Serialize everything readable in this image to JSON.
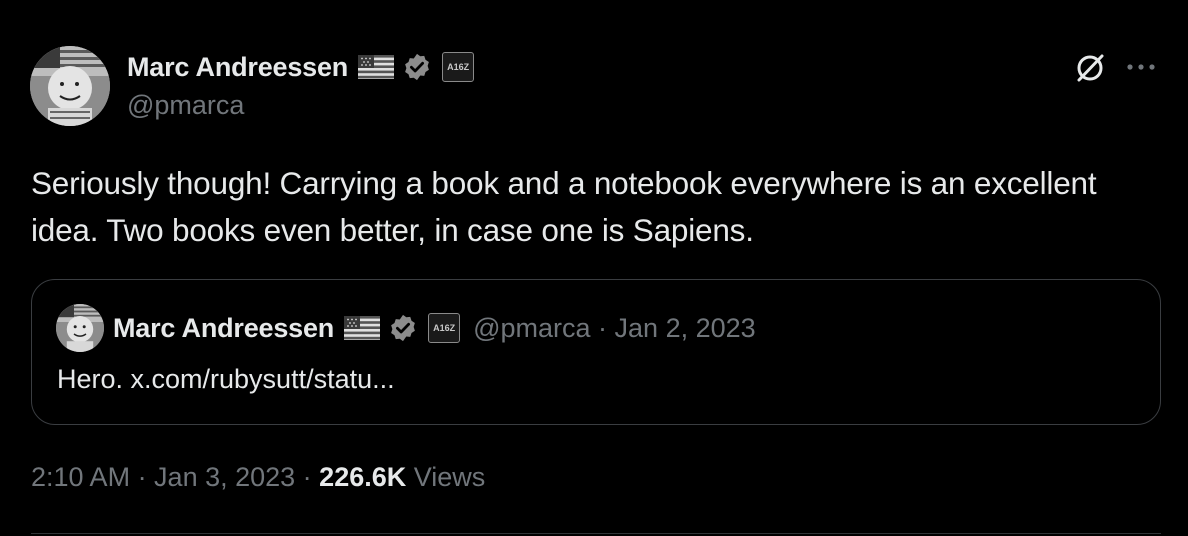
{
  "author": {
    "name": "Marc Andreessen",
    "handle": "@pmarca",
    "affiliation_badge": "A16Z"
  },
  "tweet": {
    "text": "Seriously though! Carrying a book and a notebook everywhere is an excellent idea. Two books even better, in case one is Sapiens."
  },
  "quoted_tweet": {
    "name": "Marc Andreessen",
    "affiliation_badge": "A16Z",
    "meta": "@pmarca · Jan 2, 2023",
    "text": "Hero. x.com/rubysutt/statu..."
  },
  "footer": {
    "timestamp": "2:10 AM · Jan 3, 2023 · ",
    "views_count": "226.6K",
    "views_label": " Views"
  },
  "icons": {
    "grok": "grok-icon",
    "more": "more-icon",
    "verified": "verified-badge-icon",
    "flag": "us-flag-icon"
  },
  "colors": {
    "background": "#000000",
    "primary_text": "#e7e9ea",
    "secondary_text": "#71767b",
    "border": "#3a3d41"
  }
}
